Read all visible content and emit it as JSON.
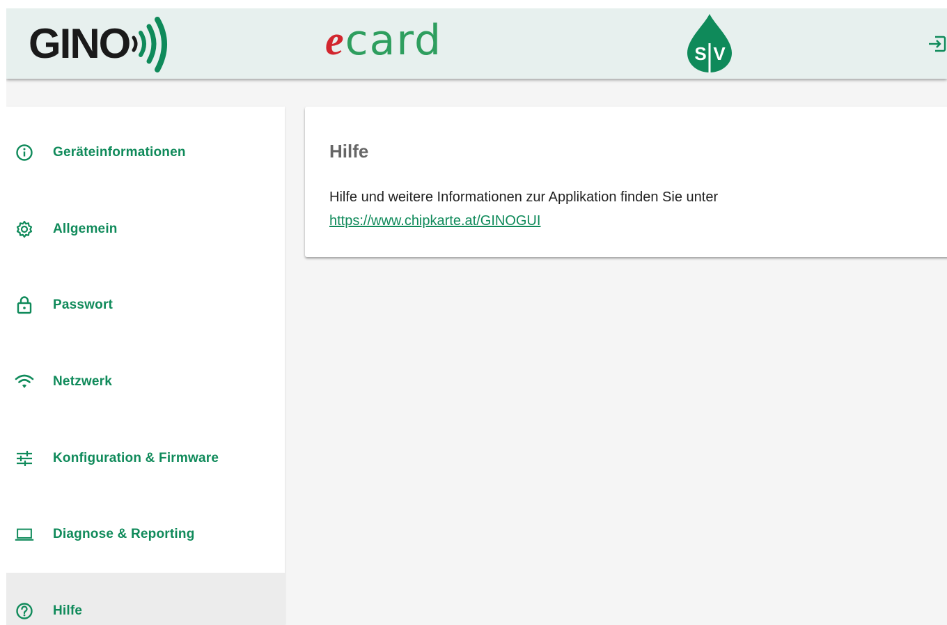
{
  "header": {
    "logo_gino_text": "GINO",
    "logo_ecard_e": "e",
    "logo_ecard_rest": "card",
    "logo_sv_text_s": "S",
    "logo_sv_text_v": "V",
    "logout_icon": "logout-icon"
  },
  "sidebar": {
    "items": [
      {
        "label": "Geräteinformationen",
        "icon": "info-icon"
      },
      {
        "label": "Allgemein",
        "icon": "gear-icon"
      },
      {
        "label": "Passwort",
        "icon": "lock-icon"
      },
      {
        "label": "Netzwerk",
        "icon": "wifi-icon"
      },
      {
        "label": "Konfiguration & Firmware",
        "icon": "tune-icon"
      },
      {
        "label": "Diagnose & Reporting",
        "icon": "laptop-icon"
      },
      {
        "label": "Hilfe",
        "icon": "help-icon",
        "active": true
      }
    ]
  },
  "main": {
    "title": "Hilfe",
    "text": "Hilfe und weitere Informationen zur Applikation finden Sie unter",
    "link": "https://www.chipkarte.at/GINOGUI"
  },
  "colors": {
    "brand_green": "#0f8a5a",
    "header_bg": "#e7f0ee",
    "ecard_red": "#d2262e",
    "ecard_green": "#2e9e5e"
  }
}
